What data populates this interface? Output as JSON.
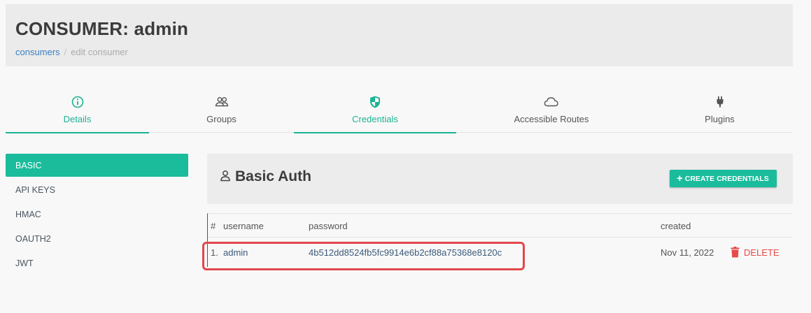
{
  "header": {
    "title": "CONSUMER: admin",
    "breadcrumb": {
      "link": "consumers",
      "separator": "/",
      "current": "edit consumer"
    }
  },
  "tabs": [
    {
      "label": "Details",
      "icon": "info-circle-icon"
    },
    {
      "label": "Groups",
      "icon": "users-icon"
    },
    {
      "label": "Credentials",
      "icon": "shield-icon"
    },
    {
      "label": "Accessible Routes",
      "icon": "cloud-icon"
    },
    {
      "label": "Plugins",
      "icon": "plug-icon"
    }
  ],
  "sidebar": {
    "items": [
      {
        "label": "BASIC",
        "active": true
      },
      {
        "label": "API KEYS"
      },
      {
        "label": "HMAC"
      },
      {
        "label": "OAUTH2"
      },
      {
        "label": "JWT"
      }
    ]
  },
  "panel": {
    "title": "Basic Auth",
    "title_icon": "user-icon",
    "create_button": {
      "label": "CREATE CREDENTIALS",
      "icon": "+"
    }
  },
  "table": {
    "columns": {
      "num": "#",
      "username": "username",
      "password": "password",
      "created": "created"
    },
    "rows": [
      {
        "num": "1.",
        "username": "admin",
        "password": "4b512dd8524fb5fc9914e6b2cf88a75368e8120c",
        "created": "Nov 11, 2022",
        "action": "DELETE"
      }
    ]
  },
  "colors": {
    "accent": "#1abc9c",
    "danger": "#e64a4a",
    "link": "#3c7fc0",
    "highlight": "#e2474b"
  }
}
